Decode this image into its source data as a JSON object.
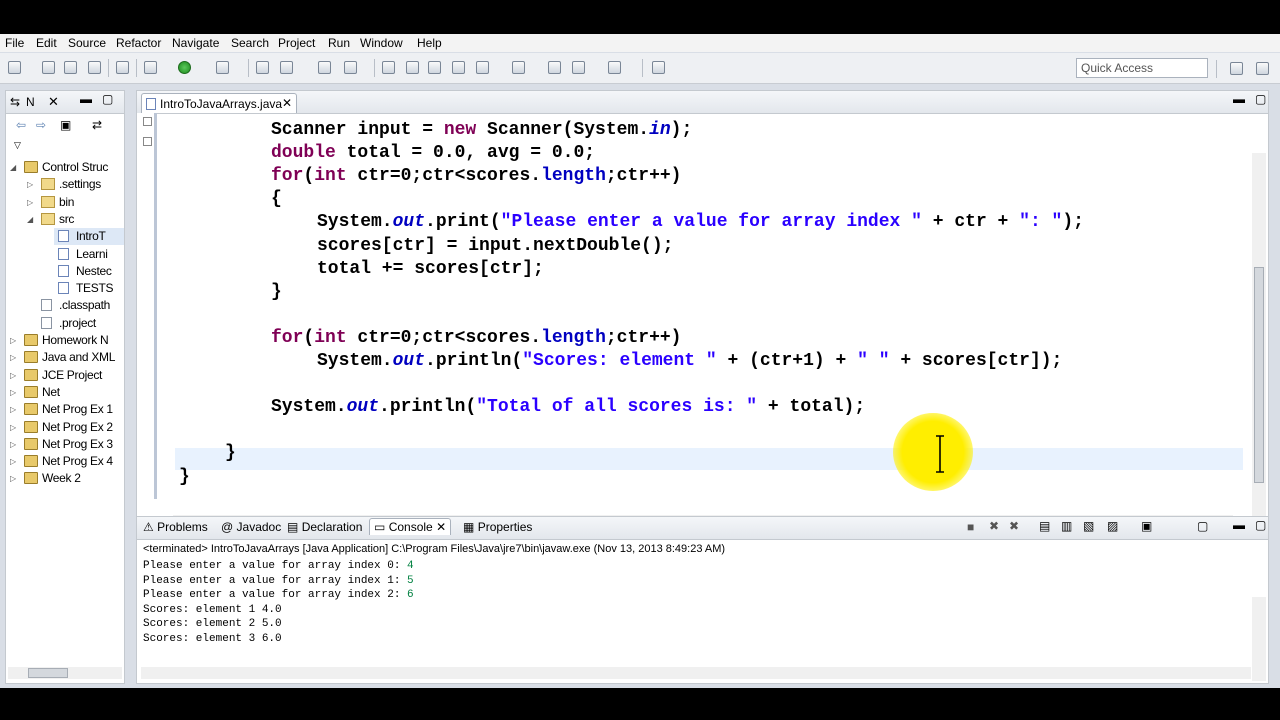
{
  "menu": [
    "File",
    "Edit",
    "Source",
    "Refactor",
    "Navigate",
    "Search",
    "Project",
    "Run",
    "Window",
    "Help"
  ],
  "quick_access": {
    "placeholder": "Quick Access"
  },
  "navigator": {
    "tab_label": "N",
    "tree": [
      {
        "label": "Control Struc",
        "kind": "project",
        "expanded": true
      },
      {
        "label": ".settings",
        "kind": "folder"
      },
      {
        "label": "bin",
        "kind": "folder"
      },
      {
        "label": "src",
        "kind": "folder",
        "expanded": true
      },
      {
        "label": "IntroT",
        "kind": "java"
      },
      {
        "label": "Learni",
        "kind": "java"
      },
      {
        "label": "Nestec",
        "kind": "java"
      },
      {
        "label": "TESTS",
        "kind": "java"
      },
      {
        "label": ".classpath",
        "kind": "file"
      },
      {
        "label": ".project",
        "kind": "file"
      },
      {
        "label": "Homework N",
        "kind": "project"
      },
      {
        "label": "Java and XML",
        "kind": "project"
      },
      {
        "label": "JCE Project",
        "kind": "project"
      },
      {
        "label": "Net",
        "kind": "project"
      },
      {
        "label": "Net Prog Ex 1",
        "kind": "project"
      },
      {
        "label": "Net Prog Ex 2",
        "kind": "project"
      },
      {
        "label": "Net Prog Ex 3",
        "kind": "project"
      },
      {
        "label": "Net Prog Ex 4",
        "kind": "project"
      },
      {
        "label": "Week 2",
        "kind": "project"
      }
    ]
  },
  "editor": {
    "tab_label": "IntroToJavaArrays.java",
    "lines": [
      {
        "indent": 2,
        "tokens": [
          [
            "",
            "Scanner input = "
          ],
          [
            "kw",
            "new"
          ],
          [
            "",
            " Scanner(System."
          ],
          [
            "fd",
            "in"
          ],
          [
            "",
            ");"
          ]
        ]
      },
      {
        "indent": 2,
        "tokens": [
          [
            "kw",
            "double"
          ],
          [
            "",
            " total = 0.0, avg = 0.0;"
          ]
        ]
      },
      {
        "indent": 2,
        "tokens": [
          [
            "kw",
            "for"
          ],
          [
            "",
            "("
          ],
          [
            "kw",
            "int"
          ],
          [
            "",
            " ctr=0;ctr<scores."
          ],
          [
            "fn",
            "length"
          ],
          [
            "",
            ";ctr++)"
          ]
        ]
      },
      {
        "indent": 2,
        "tokens": [
          [
            "",
            "{"
          ]
        ]
      },
      {
        "indent": 3,
        "tokens": [
          [
            "",
            "System."
          ],
          [
            "fd",
            "out"
          ],
          [
            "",
            ".print("
          ],
          [
            "st",
            "\"Please enter a value for array index \""
          ],
          [
            "",
            " + ctr + "
          ],
          [
            "st",
            "\": \""
          ],
          [
            "",
            ");"
          ]
        ]
      },
      {
        "indent": 3,
        "tokens": [
          [
            "",
            "scores[ctr] = input.nextDouble();"
          ]
        ]
      },
      {
        "indent": 3,
        "tokens": [
          [
            "",
            "total += scores[ctr];"
          ]
        ]
      },
      {
        "indent": 2,
        "tokens": [
          [
            "",
            "}"
          ]
        ]
      },
      {
        "indent": 0,
        "tokens": []
      },
      {
        "indent": 2,
        "tokens": [
          [
            "kw",
            "for"
          ],
          [
            "",
            "("
          ],
          [
            "kw",
            "int"
          ],
          [
            "",
            " ctr=0;ctr<scores."
          ],
          [
            "fn",
            "length"
          ],
          [
            "",
            ";ctr++)"
          ]
        ]
      },
      {
        "indent": 3,
        "tokens": [
          [
            "",
            "System."
          ],
          [
            "fd",
            "out"
          ],
          [
            "",
            ".println("
          ],
          [
            "st",
            "\"Scores: element \""
          ],
          [
            "",
            " + (ctr+1) + "
          ],
          [
            "st",
            "\" \""
          ],
          [
            "",
            " + scores[ctr]);"
          ]
        ]
      },
      {
        "indent": 0,
        "tokens": []
      },
      {
        "indent": 2,
        "tokens": [
          [
            "",
            "System."
          ],
          [
            "fd",
            "out"
          ],
          [
            "",
            ".println("
          ],
          [
            "st",
            "\"Total of all scores is: \""
          ],
          [
            "",
            " + total);"
          ]
        ]
      },
      {
        "indent": 0,
        "tokens": []
      },
      {
        "indent": 1,
        "tokens": [
          [
            "",
            "}"
          ]
        ]
      },
      {
        "indent": 0,
        "tokens": [
          [
            "",
            "}"
          ]
        ]
      }
    ]
  },
  "console": {
    "tabs": [
      "Problems",
      "Javadoc",
      "Declaration",
      "Console",
      "Properties"
    ],
    "active_tab": "Console",
    "status": "<terminated> IntroToJavaArrays [Java Application] C:\\Program Files\\Java\\jre7\\bin\\javaw.exe (Nov 13, 2013 8:49:23 AM)",
    "output": [
      {
        "text": "Please enter a value for array index 0: ",
        "input": "4"
      },
      {
        "text": "Please enter a value for array index 1: ",
        "input": "5"
      },
      {
        "text": "Please enter a value for array index 2: ",
        "input": "6"
      },
      {
        "text": "Scores: element 1 4.0",
        "input": ""
      },
      {
        "text": "Scores: element 2 5.0",
        "input": ""
      },
      {
        "text": "Scores: element 3 6.0",
        "input": ""
      }
    ]
  },
  "colors": {
    "keyword": "#7f0055",
    "string": "#2a00ff",
    "field": "#0000c0",
    "console_input": "#008040",
    "highlight": "#ffee00"
  }
}
